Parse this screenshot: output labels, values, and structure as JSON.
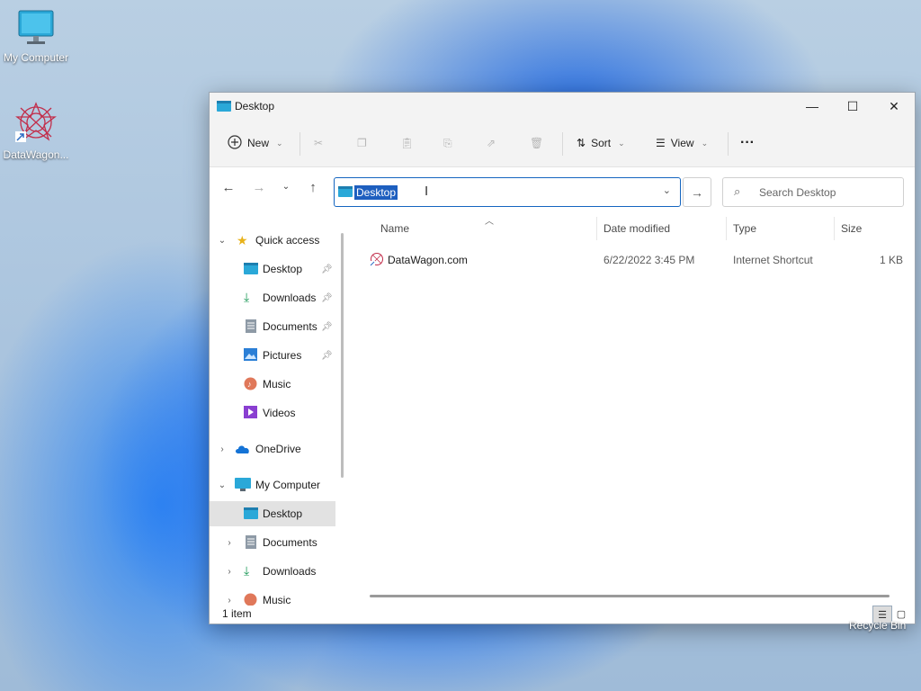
{
  "desktop": {
    "icons": [
      {
        "label": "My Computer"
      },
      {
        "label": "DataWagon..."
      }
    ],
    "recycle_label": "Recycle Bin"
  },
  "window": {
    "title": "Desktop",
    "controls": {
      "minimize": "—",
      "maximize": "☐",
      "close": "✕"
    }
  },
  "toolbar": {
    "new_label": "New",
    "sort_label": "Sort",
    "view_label": "View",
    "more_label": "···"
  },
  "nav": {
    "address_value": "Desktop",
    "search_placeholder": "Search Desktop"
  },
  "sidebar": {
    "quick_access": "Quick access",
    "quick_items": [
      {
        "label": "Desktop",
        "pinned": true
      },
      {
        "label": "Downloads",
        "pinned": true
      },
      {
        "label": "Documents",
        "pinned": true
      },
      {
        "label": "Pictures",
        "pinned": true
      },
      {
        "label": "Music",
        "pinned": false
      },
      {
        "label": "Videos",
        "pinned": false
      }
    ],
    "onedrive": "OneDrive",
    "my_computer": "My Computer",
    "computer_items": [
      {
        "label": "Desktop"
      },
      {
        "label": "Documents"
      },
      {
        "label": "Downloads"
      },
      {
        "label": "Music"
      }
    ]
  },
  "columns": {
    "name": "Name",
    "date": "Date modified",
    "type": "Type",
    "size": "Size"
  },
  "files": [
    {
      "name": "DataWagon.com",
      "date": "6/22/2022 3:45 PM",
      "type": "Internet Shortcut",
      "size": "1 KB"
    }
  ],
  "status": {
    "count": "1 item"
  },
  "colors": {
    "accent": "#1565c0",
    "selection": "#1e5fbf"
  }
}
